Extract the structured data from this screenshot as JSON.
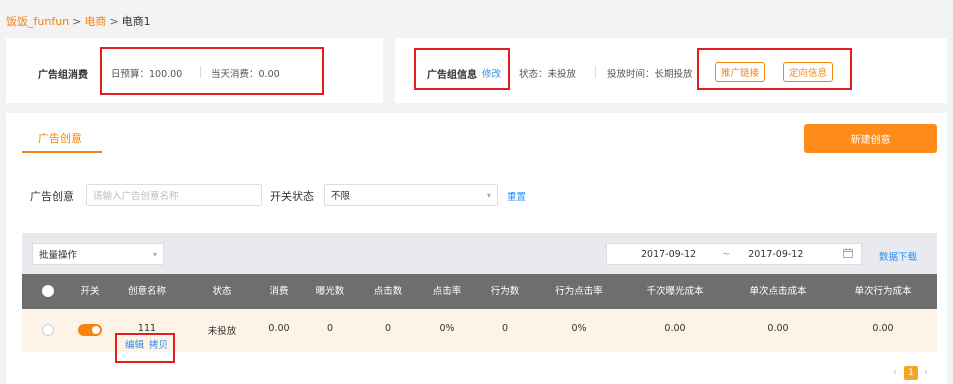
{
  "breadcrumb": {
    "items": [
      "饭饭_funfun",
      "电商"
    ],
    "separator": ">",
    "current": "电商1"
  },
  "spend_card": {
    "label": "广告组消费",
    "daily_budget": "日预算：100.00",
    "today_spend": "当天消费：0.00"
  },
  "info_card": {
    "label": "广告组信息",
    "edit_link": "修改",
    "status": "状态：未投放",
    "schedule": "投放时间：长期投放",
    "promo_link_button": "推广链接",
    "targeting_button": "定向信息"
  },
  "tabs": {
    "active": "广告创意"
  },
  "new_creative_button": "新建创意",
  "filters": {
    "creative_label": "广告创意",
    "creative_placeholder": "请输入广告创意名称",
    "switch_label": "开关状态",
    "switch_value": "不限",
    "reset_link": "重置"
  },
  "toolbar": {
    "batch_select": "批量操作",
    "date_start": "2017-09-12",
    "date_separator": "~",
    "date_end": "2017-09-12",
    "download_link": "数据下载"
  },
  "table": {
    "headers": [
      "开关",
      "创意名称",
      "状态",
      "消费",
      "曝光数",
      "点击数",
      "点击率",
      "行为数",
      "行为点击率",
      "千次曝光成本",
      "单次点击成本",
      "单次行为成本"
    ],
    "rows": [
      {
        "switch_on": true,
        "name": "111",
        "status": "未投放",
        "spend": "0.00",
        "impressions": "0",
        "clicks": "0",
        "ctr": "0%",
        "actions": "0",
        "action_ctr": "0%",
        "cpm": "0.00",
        "cpc": "0.00",
        "cpa": "0.00",
        "edit_link": "编辑",
        "copy_link": "拷贝"
      }
    ]
  },
  "pagination": {
    "current_page": "1",
    "prev": "‹",
    "next": "›"
  },
  "colors": {
    "accent": "#f5830d",
    "primary_button": "#ff8c1a",
    "link": "#2d8cf0",
    "highlight_box": "#e02020",
    "table_header": "#6e6e6e",
    "row_bg": "#fdf3e6"
  }
}
